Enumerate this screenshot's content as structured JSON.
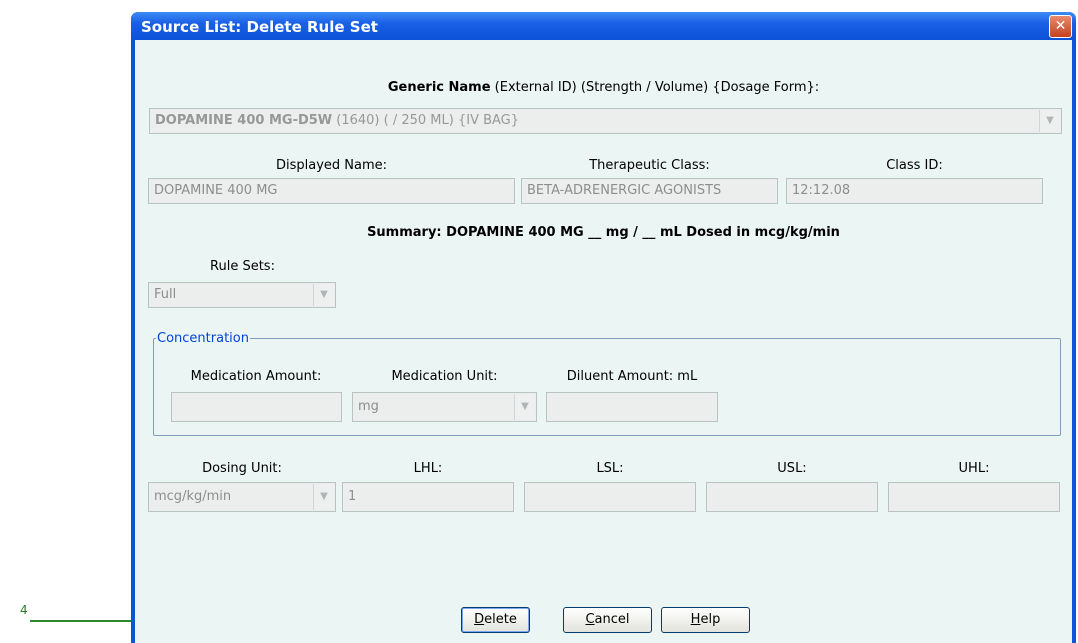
{
  "callout": {
    "number": "4"
  },
  "window": {
    "title": "Source List:  Delete Rule Set",
    "close_glyph": "✕"
  },
  "generic": {
    "header_bold": "Generic Name",
    "header_rest": " (External ID)  (Strength / Volume)  {Dosage Form}:",
    "name": "DOPAMINE 400 MG-D5W",
    "details": "  (1640)  (  / 250 ML)  {IV BAG}"
  },
  "labels": {
    "displayed_name": "Displayed Name:",
    "therapeutic_class": "Therapeutic Class:",
    "class_id": "Class ID:",
    "rule_sets": "Rule Sets:",
    "concentration": "Concentration",
    "medication_amount": "Medication Amount:",
    "medication_unit": "Medication Unit:",
    "diluent_amount": "Diluent Amount: mL",
    "dosing_unit": "Dosing Unit:",
    "lhl": "LHL:",
    "lsl": "LSL:",
    "usl": "USL:",
    "uhl": "UHL:"
  },
  "values": {
    "displayed_name": "DOPAMINE 400 MG",
    "therapeutic_class": "BETA-ADRENERGIC AGONISTS",
    "class_id": "12:12.08",
    "rule_set": "Full",
    "medication_amount": "",
    "medication_unit": "mg",
    "diluent_amount": "",
    "dosing_unit": "mcg/kg/min",
    "lhl": "1",
    "lsl": "",
    "usl": "",
    "uhl": ""
  },
  "summary": "Summary:  DOPAMINE 400 MG __ mg / __ mL Dosed in mcg/kg/min",
  "buttons": {
    "delete": {
      "mnemonic": "D",
      "rest": "elete"
    },
    "cancel": {
      "mnemonic": "C",
      "rest": "ancel"
    },
    "help": {
      "mnemonic": "H",
      "rest": "elp"
    }
  },
  "icons": {
    "dropdown": "chevron-down-icon",
    "close": "close-icon"
  },
  "colors": {
    "titlebar": "#0b52d8",
    "client_bg": "#ebf5f4",
    "legend": "#0046d5",
    "callout": "#2a8a2a"
  }
}
